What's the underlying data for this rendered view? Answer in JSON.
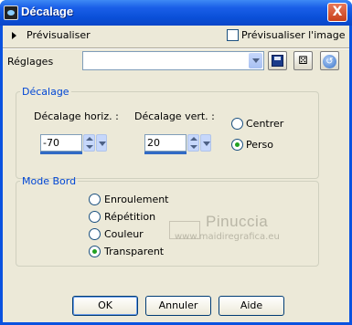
{
  "window": {
    "title": "Décalage",
    "close_label": "X"
  },
  "preview": {
    "label": "Prévisualiser",
    "image_label": "Prévisualiser l'image"
  },
  "settings": {
    "label": "Réglages",
    "value": ""
  },
  "offset_group": {
    "legend": "Décalage",
    "horiz_label": "Décalage horiz. :",
    "horiz_value": "-70",
    "vert_label": "Décalage vert. :",
    "vert_value": "20",
    "options": [
      "Centrer",
      "Perso"
    ],
    "selected": "Perso"
  },
  "border_group": {
    "legend": "Mode Bord",
    "options": [
      "Enroulement",
      "Répétition",
      "Couleur",
      "Transparent"
    ],
    "selected": "Transparent"
  },
  "watermark": {
    "title": "Pinuccia",
    "url": "www.maidiregrafica.eu"
  },
  "buttons": {
    "ok": "OK",
    "cancel": "Annuler",
    "help": "Aide"
  },
  "colors": {
    "title_bar": "#0a4fd8",
    "dialog_bg": "#ece9d8",
    "legend": "#0046d5"
  }
}
